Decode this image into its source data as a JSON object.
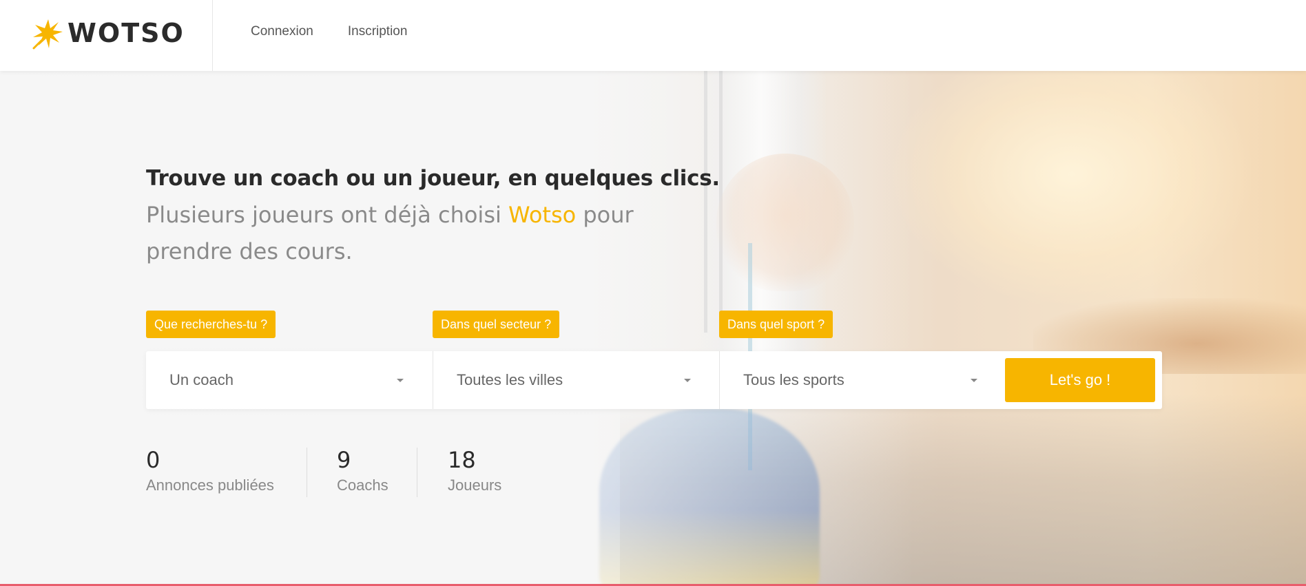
{
  "header": {
    "logo_text": "WOTSO",
    "nav": [
      {
        "label": "Connexion"
      },
      {
        "label": "Inscription"
      }
    ]
  },
  "hero": {
    "headline": "Trouve un coach ou un joueur, en quelques clics.",
    "subline_before": "Plusieurs joueurs ont déjà choisi ",
    "subline_brand": "Wotso",
    "subline_after": " pour prendre des cours."
  },
  "search": {
    "tags": {
      "what": "Que recherches-tu ?",
      "where": "Dans quel secteur ?",
      "sport": "Dans quel sport ?"
    },
    "fields": {
      "what": "Un coach",
      "where": "Toutes les villes",
      "sport": "Tous les sports"
    },
    "submit_label": "Let's go !"
  },
  "stats": [
    {
      "value": "0",
      "label": "Annonces publiées"
    },
    {
      "value": "9",
      "label": "Coachs"
    },
    {
      "value": "18",
      "label": "Joueurs"
    }
  ],
  "colors": {
    "accent": "#f7b500",
    "bottom_border": "#e85d6c"
  }
}
